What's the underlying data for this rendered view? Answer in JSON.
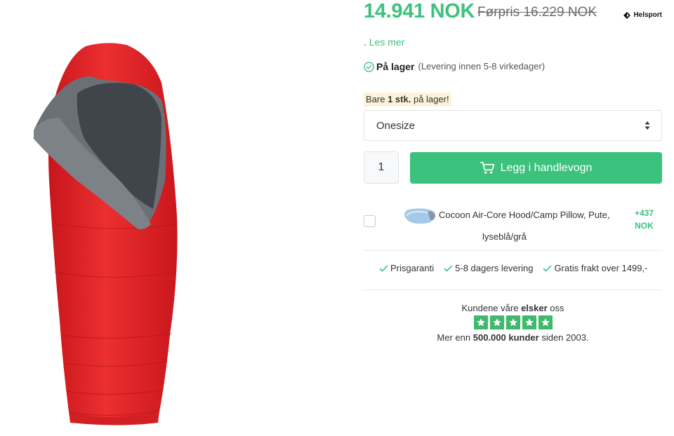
{
  "product": {
    "price": "14.941 NOK",
    "old_price": "Førpris 16.229 NOK",
    "brand": "Helsport",
    "read_more_prefix": ".",
    "read_more": "Les mer",
    "stock_label": "På lager",
    "stock_sub": "(Levering innen 5-8 virkedager)",
    "low_stock_prefix": "Bare",
    "low_stock_count": "1 stk.",
    "low_stock_suffix": "på lager!",
    "size_selected": "Onesize",
    "quantity": "1",
    "add_to_cart": "Legg i handlevogn"
  },
  "addon": {
    "name_line1": "Cocoon Air-Core Hood/Camp Pillow, Pute,",
    "name_line2": "lyseblå/grå",
    "price_line1": "+437",
    "price_line2": "NOK"
  },
  "benefits": [
    "Prisgaranti",
    "5-8 dagers levering",
    "Gratis frakt over 1499,-"
  ],
  "reviews": {
    "prefix": "Kundene våre",
    "bold": "elsker",
    "suffix": "oss",
    "stars": 5,
    "line2_prefix": "Mer enn",
    "line2_bold": "500.000 kunder",
    "line2_suffix": "siden 2003."
  },
  "colors": {
    "accent": "#3cc27d",
    "product_red": "#e2262b",
    "lining_gray": "#6b7077",
    "star_green": "#3fba6d"
  }
}
